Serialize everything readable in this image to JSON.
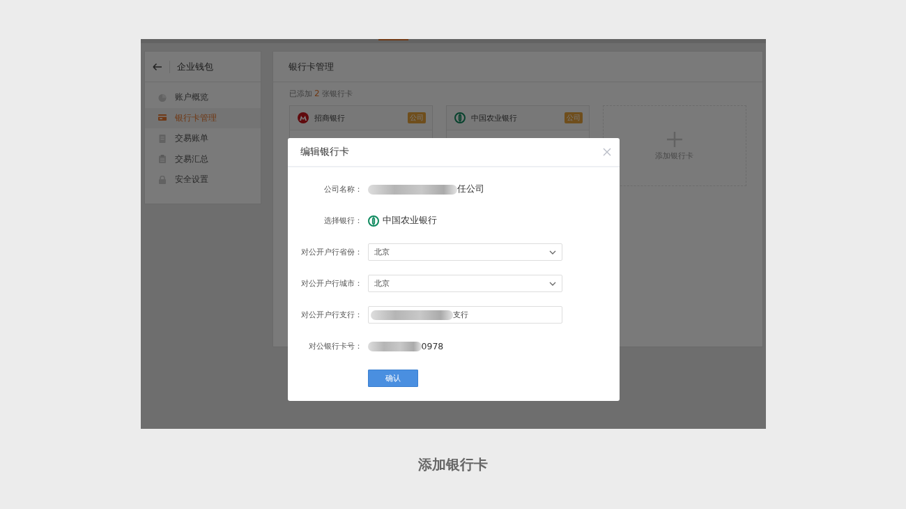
{
  "sidebar": {
    "title": "企业钱包",
    "items": [
      {
        "label": "账户概览",
        "selected": false
      },
      {
        "label": "银行卡管理",
        "selected": true
      },
      {
        "label": "交易账单",
        "selected": false
      },
      {
        "label": "交易汇总",
        "selected": false
      },
      {
        "label": "安全设置",
        "selected": false
      }
    ]
  },
  "main": {
    "title": "银行卡管理",
    "summary": {
      "before": "已添加",
      "count": "2",
      "after": "张银行卡"
    },
    "cards": [
      {
        "bank": "招商银行",
        "tag": "公司"
      },
      {
        "bank": "中国农业银行",
        "tag": "公司"
      }
    ],
    "add_card": "添加银行卡"
  },
  "dialog": {
    "title": "编辑银行卡",
    "fields": [
      {
        "kind": "text",
        "label": "公司名称：",
        "value": "任公司",
        "redacted": true
      },
      {
        "kind": "bank",
        "label": "选择银行：",
        "value": "中国农业银行"
      },
      {
        "kind": "select",
        "label": "对公开户行省份：",
        "value": "北京"
      },
      {
        "kind": "select",
        "label": "对公开户行城市：",
        "value": "北京"
      },
      {
        "kind": "input",
        "label": "对公开户行支行：",
        "value": "支行",
        "redacted": true
      },
      {
        "kind": "text",
        "label": "对公银行卡号：",
        "value": "0978",
        "redacted": true
      }
    ],
    "confirm": "确认"
  },
  "caption": "添加银行卡"
}
